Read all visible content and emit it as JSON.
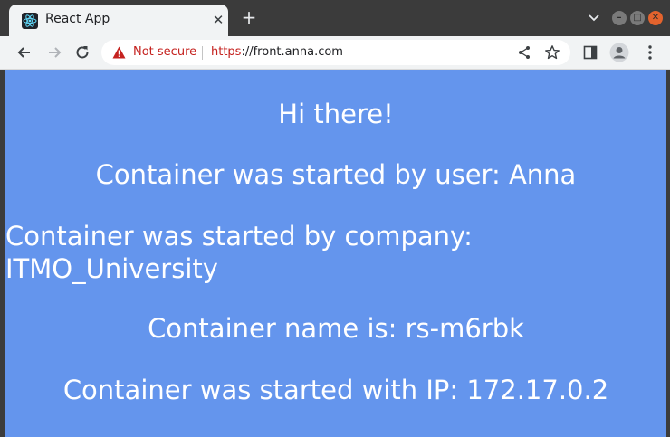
{
  "browser": {
    "tab_title": "React App",
    "address": {
      "security_label": "Not secure",
      "url_scheme": "https",
      "url_rest": "://front.anna.com"
    }
  },
  "page": {
    "greeting": "Hi there!",
    "user_line": "Container was started by user: Anna",
    "company_line": "Container was started by company: ITMO_University",
    "name_line": "Container name is: rs-m6rbk",
    "ip_line": "Container was started with IP: 172.17.0.2"
  },
  "colors": {
    "page_background": "#6495ed",
    "page_text": "#ffffff",
    "insecure_red": "#c5221f"
  }
}
